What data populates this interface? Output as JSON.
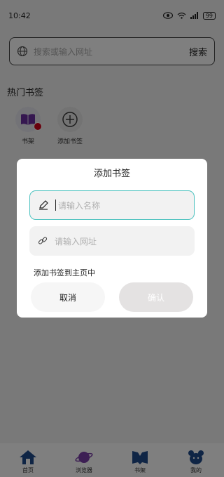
{
  "status_bar": {
    "time": "10:42",
    "battery": "99"
  },
  "search": {
    "placeholder": "搜索或输入网址",
    "button": "搜索"
  },
  "section_title": "热门书签",
  "bookmarks": [
    {
      "label": "书架",
      "icon": "book-icon"
    },
    {
      "label": "添加书签",
      "icon": "plus-icon"
    }
  ],
  "dialog": {
    "title": "添加书签",
    "name_placeholder": "请输入名称",
    "url_placeholder": "请输入网址",
    "add_to_home": "添加书签到主页中",
    "cancel": "取消",
    "confirm": "确认"
  },
  "nav": [
    {
      "label": "首页",
      "icon": "home-icon"
    },
    {
      "label": "浏览器",
      "icon": "planet-icon"
    },
    {
      "label": "书架",
      "icon": "bookshelf-icon"
    },
    {
      "label": "我的",
      "icon": "bear-icon"
    }
  ],
  "colors": {
    "accent": "#1f4a8a",
    "nav_purple": "#7b3fa8",
    "focus_border": "#4fc3c0",
    "badge": "#d0021b"
  }
}
